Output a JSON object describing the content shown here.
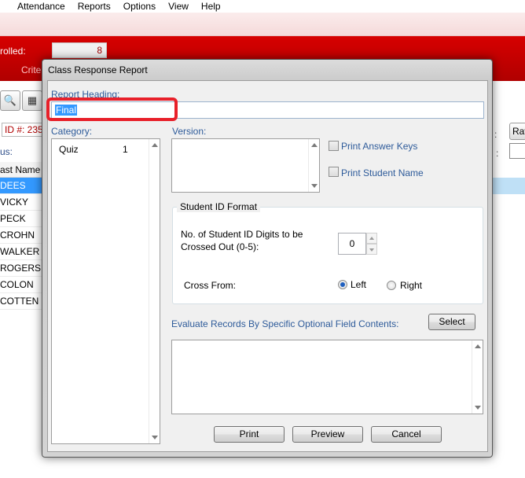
{
  "menu": [
    "Attendance",
    "Reports",
    "Options",
    "View",
    "Help"
  ],
  "background": {
    "enrolled_label": "rolled:",
    "enrolled_value": "8",
    "criteria_label": "Crite",
    "id_label": "ID #: 235",
    "us_label": "us:",
    "column_header": "ast Name",
    "names": [
      "DEES",
      "VICKY",
      "PECK",
      "CROHN",
      "WALKER",
      "ROGERS",
      "COLON",
      "COTTEN"
    ],
    "raw_label": "Rav"
  },
  "dialog": {
    "title": "Class Response Report",
    "report_heading_label": "Report Heading:",
    "report_heading_value": "Final",
    "category_label": "Category:",
    "categories": [
      {
        "name": "Quiz",
        "count": "1"
      }
    ],
    "version_label": "Version:",
    "print_answer_keys_label": "Print Answer Keys",
    "print_student_name_label": "Print Student Name",
    "student_id_group_title": "Student ID Format",
    "digits_label_line1": "No. of Student ID Digits to be",
    "digits_label_line2": "Crossed Out (0-5):",
    "digits_value": "0",
    "cross_from_label": "Cross From:",
    "left_label": "Left",
    "right_label": "Right",
    "cross_from_selected": "Left",
    "evaluate_label": "Evaluate Records By Specific Optional Field Contents:",
    "select_button": "Select",
    "print_button": "Print",
    "preview_button": "Preview",
    "cancel_button": "Cancel"
  }
}
